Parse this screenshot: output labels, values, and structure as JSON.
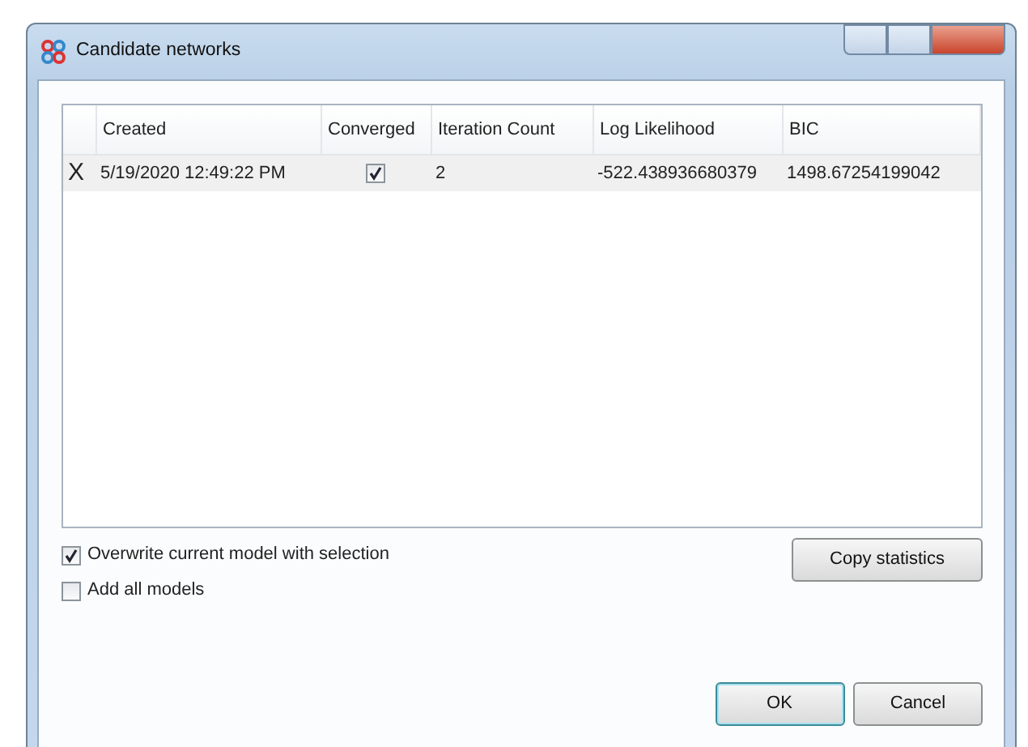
{
  "window": {
    "title": "Candidate networks"
  },
  "table": {
    "columns": [
      "Created",
      "Converged",
      "Iteration Count",
      "Log Likelihood",
      "BIC"
    ],
    "rows": [
      {
        "marker": "X",
        "created": "5/19/2020 12:49:22 PM",
        "converged": true,
        "iteration_count": "2",
        "log_likelihood": "-522.438936680379",
        "bic": "1498.67254199042"
      }
    ]
  },
  "options": [
    {
      "label": "Overwrite current model with selection",
      "checked": true
    },
    {
      "label": "Add all models",
      "checked": false
    }
  ],
  "buttons": [
    {
      "label": "Copy statistics",
      "kind": "side",
      "default": false
    },
    {
      "label": "OK",
      "kind": "footer",
      "default": true
    },
    {
      "label": "Cancel",
      "kind": "footer",
      "default": false
    }
  ]
}
